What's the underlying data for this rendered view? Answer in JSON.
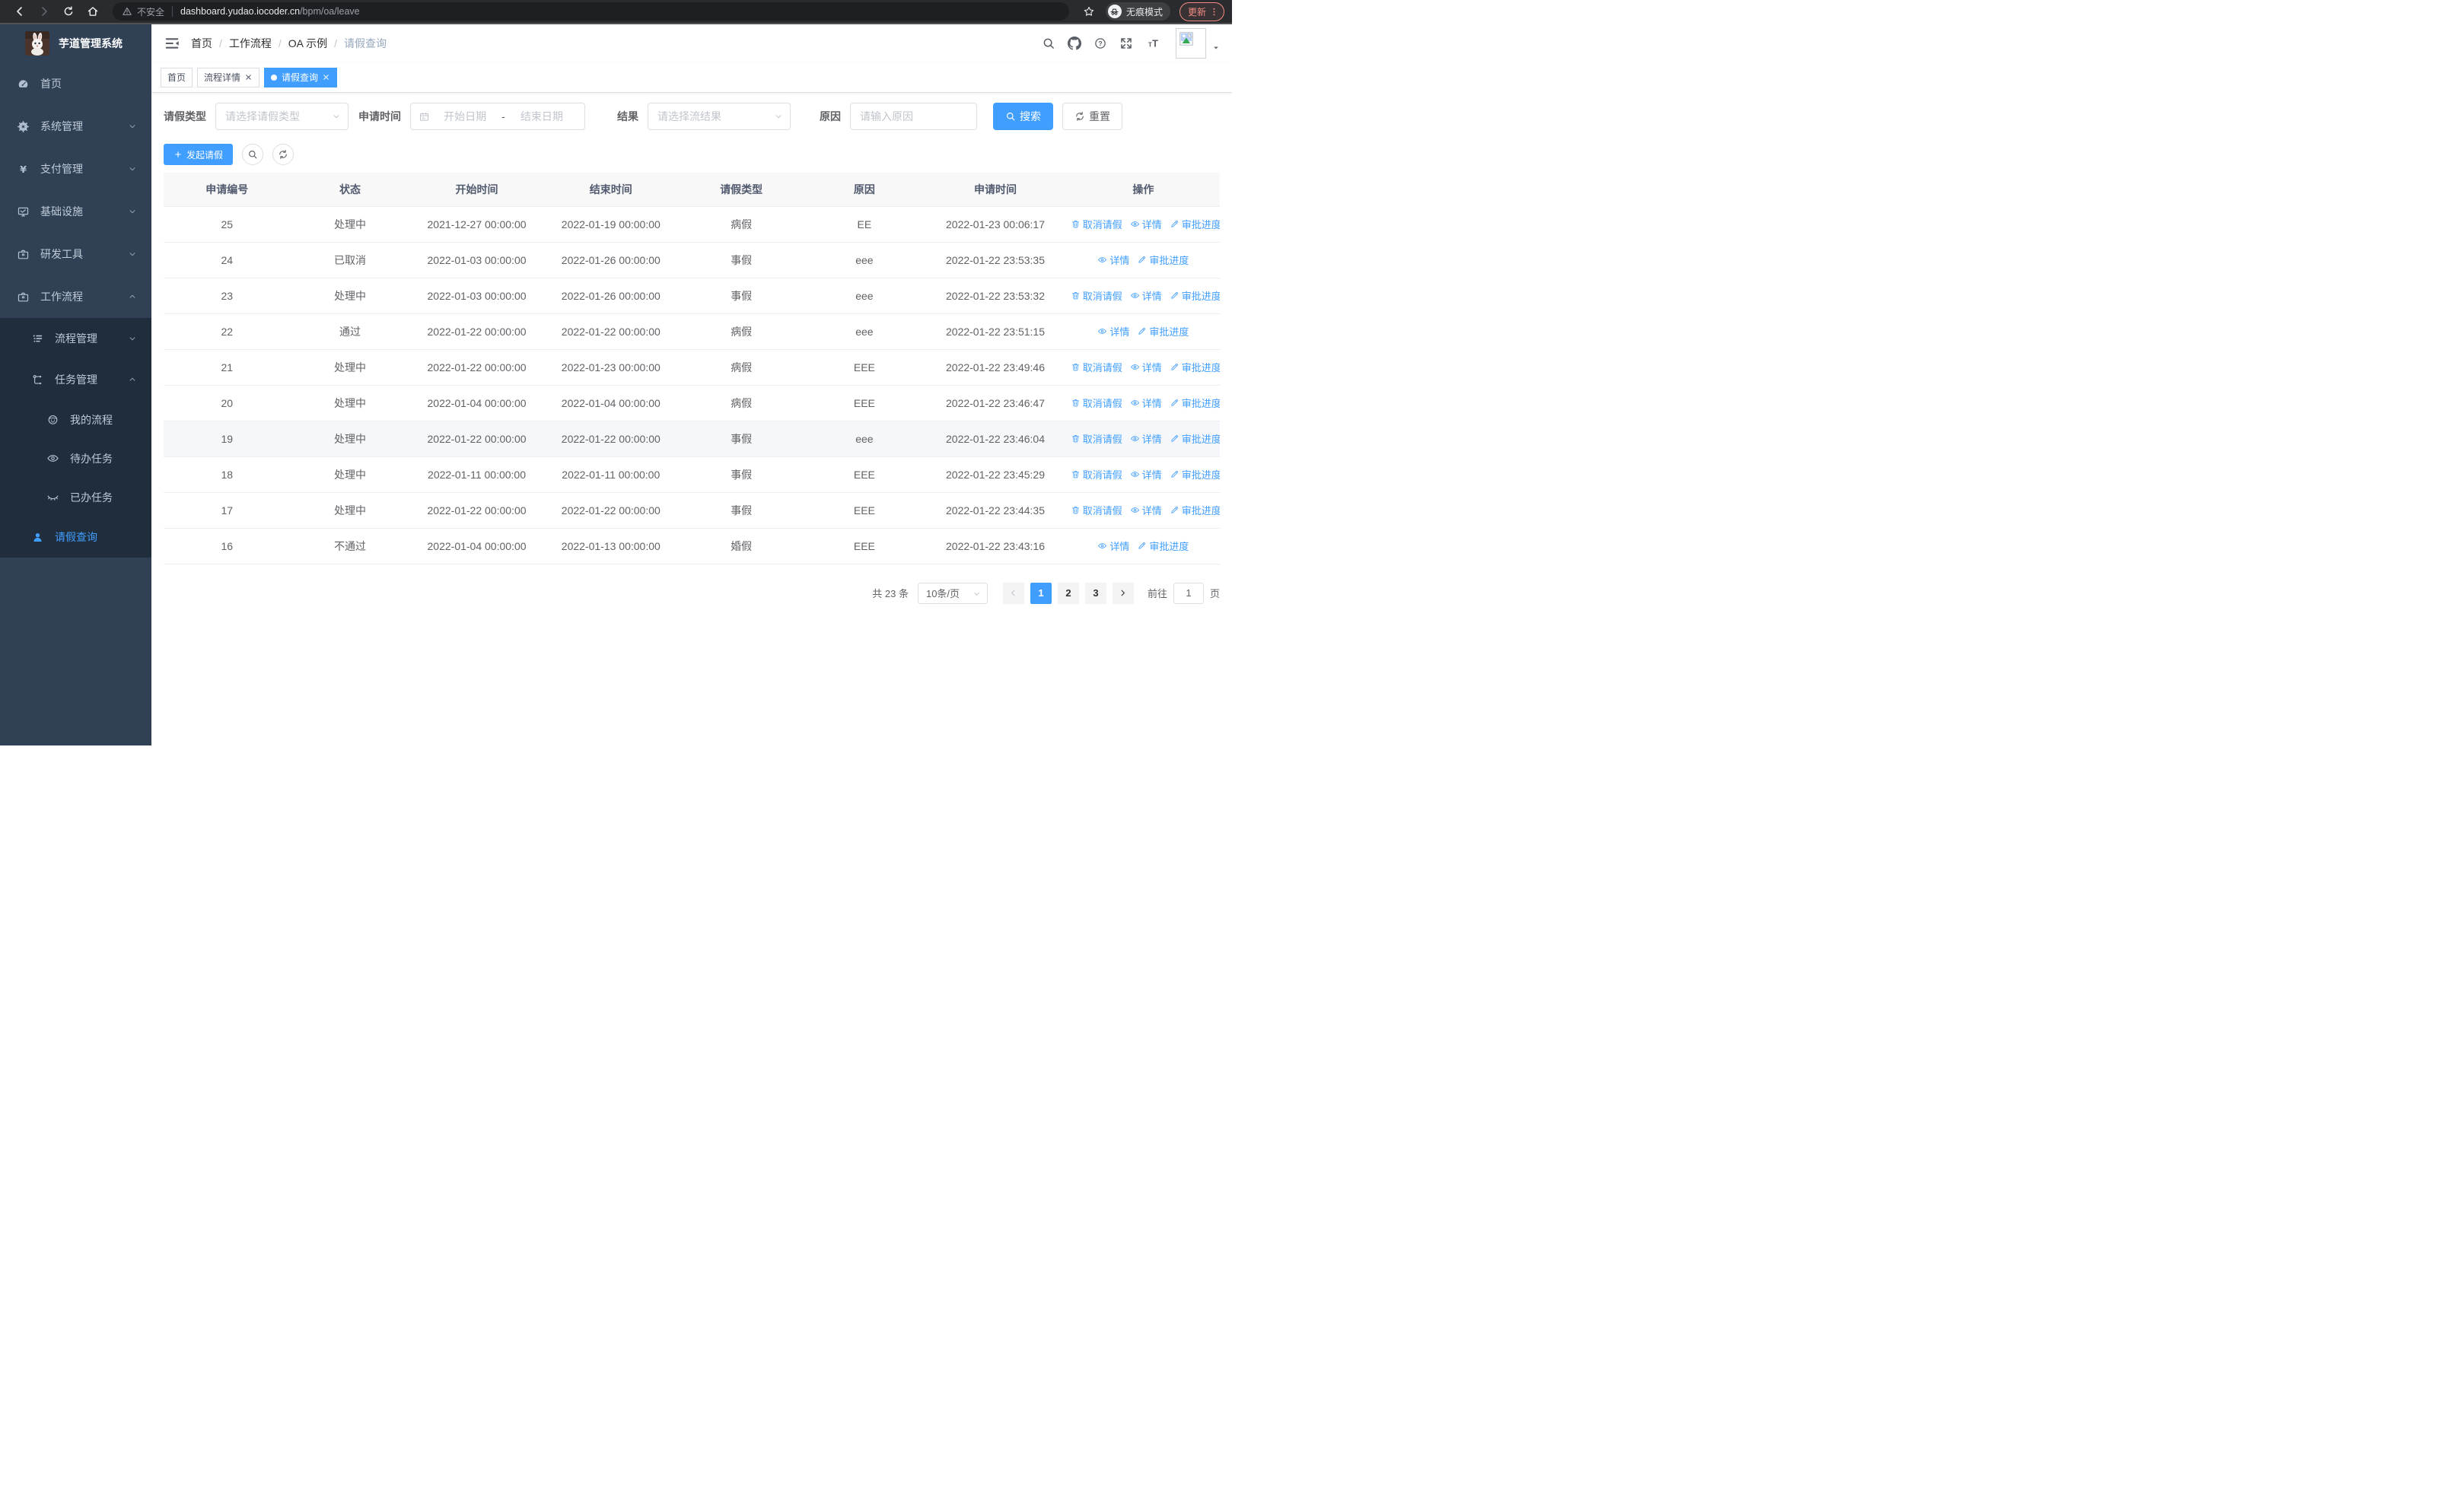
{
  "theme": {
    "accent": "#409eff",
    "sidebar_bg": "#304156",
    "sidebar_submenu_bg": "#1f2d3d",
    "chrome_bg": "#2a2b2e",
    "update_badge_color": "#f28b82",
    "table_header_bg": "#f8f8f9"
  },
  "browser": {
    "security_label": "不安全",
    "url_host": "dashboard.yudao.iocoder.cn",
    "url_path": "/bpm/oa/leave",
    "incognito_label": "无痕模式",
    "update_label": "更新",
    "icons": [
      "back-arrow",
      "forward-arrow",
      "reload",
      "home",
      "warning-triangle",
      "star",
      "incognito",
      "kebab-menu"
    ]
  },
  "sidebar": {
    "app_title": "芋道管理系统",
    "items": [
      {
        "label": "首页",
        "icon": "dashboard-gauge"
      },
      {
        "label": "系统管理",
        "icon": "gear"
      },
      {
        "label": "支付管理",
        "icon": "yen"
      },
      {
        "label": "基础设施",
        "icon": "monitor"
      },
      {
        "label": "研发工具",
        "icon": "toolbox"
      },
      {
        "label": "工作流程",
        "icon": "briefcase"
      },
      {
        "label": "流程管理",
        "icon": "list"
      },
      {
        "label": "任务管理",
        "icon": "flow-tree"
      },
      {
        "label": "我的流程",
        "icon": "face"
      },
      {
        "label": "待办任务",
        "icon": "eye-open"
      },
      {
        "label": "已办任务",
        "icon": "eye-closed"
      },
      {
        "label": "请假查询",
        "icon": "person"
      }
    ]
  },
  "header": {
    "breadcrumb": [
      "首页",
      "工作流程",
      "OA 示例",
      "请假查询"
    ],
    "right_icons": [
      "search",
      "github",
      "question",
      "fullscreen",
      "font-size",
      "avatar-placeholder",
      "caret-down"
    ]
  },
  "tabs": [
    {
      "label": "首页"
    },
    {
      "label": "流程详情"
    },
    {
      "label": "请假查询"
    }
  ],
  "filters": {
    "leave_type_label": "请假类型",
    "leave_type_placeholder": "请选择请假类型",
    "apply_time_label": "申请时间",
    "start_date_placeholder": "开始日期",
    "range_separator": "-",
    "end_date_placeholder": "结束日期",
    "result_label": "结果",
    "result_placeholder": "请选择流结果",
    "reason_label": "原因",
    "reason_placeholder": "请输入原因",
    "search_label": "搜索",
    "reset_label": "重置"
  },
  "toolbar": {
    "create_label": "发起请假"
  },
  "table": {
    "columns": [
      "申请编号",
      "状态",
      "开始时间",
      "结束时间",
      "请假类型",
      "原因",
      "申请时间",
      "操作"
    ],
    "actions": {
      "cancel": "取消请假",
      "detail": "详情",
      "progress": "审批进度"
    },
    "rows": [
      {
        "id": "25",
        "status": "处理中",
        "start": "2021-12-27 00:00:00",
        "end": "2022-01-19 00:00:00",
        "type": "病假",
        "reason": "EE",
        "applied": "2022-01-23 00:06:17"
      },
      {
        "id": "24",
        "status": "已取消",
        "start": "2022-01-03 00:00:00",
        "end": "2022-01-26 00:00:00",
        "type": "事假",
        "reason": "eee",
        "applied": "2022-01-22 23:53:35"
      },
      {
        "id": "23",
        "status": "处理中",
        "start": "2022-01-03 00:00:00",
        "end": "2022-01-26 00:00:00",
        "type": "事假",
        "reason": "eee",
        "applied": "2022-01-22 23:53:32"
      },
      {
        "id": "22",
        "status": "通过",
        "start": "2022-01-22 00:00:00",
        "end": "2022-01-22 00:00:00",
        "type": "病假",
        "reason": "eee",
        "applied": "2022-01-22 23:51:15"
      },
      {
        "id": "21",
        "status": "处理中",
        "start": "2022-01-22 00:00:00",
        "end": "2022-01-23 00:00:00",
        "type": "病假",
        "reason": "EEE",
        "applied": "2022-01-22 23:49:46"
      },
      {
        "id": "20",
        "status": "处理中",
        "start": "2022-01-04 00:00:00",
        "end": "2022-01-04 00:00:00",
        "type": "病假",
        "reason": "EEE",
        "applied": "2022-01-22 23:46:47"
      },
      {
        "id": "19",
        "status": "处理中",
        "start": "2022-01-22 00:00:00",
        "end": "2022-01-22 00:00:00",
        "type": "事假",
        "reason": "eee",
        "applied": "2022-01-22 23:46:04"
      },
      {
        "id": "18",
        "status": "处理中",
        "start": "2022-01-11 00:00:00",
        "end": "2022-01-11 00:00:00",
        "type": "事假",
        "reason": "EEE",
        "applied": "2022-01-22 23:45:29"
      },
      {
        "id": "17",
        "status": "处理中",
        "start": "2022-01-22 00:00:00",
        "end": "2022-01-22 00:00:00",
        "type": "事假",
        "reason": "EEE",
        "applied": "2022-01-22 23:44:35"
      },
      {
        "id": "16",
        "status": "不通过",
        "start": "2022-01-04 00:00:00",
        "end": "2022-01-13 00:00:00",
        "type": "婚假",
        "reason": "EEE",
        "applied": "2022-01-22 23:43:16"
      }
    ]
  },
  "pagination": {
    "total": "共 23 条",
    "page_size": "10条/页",
    "pages": [
      "1",
      "2",
      "3"
    ],
    "active_page": "1",
    "goto_label": "前往",
    "goto_value": "1",
    "page_unit": "页"
  }
}
